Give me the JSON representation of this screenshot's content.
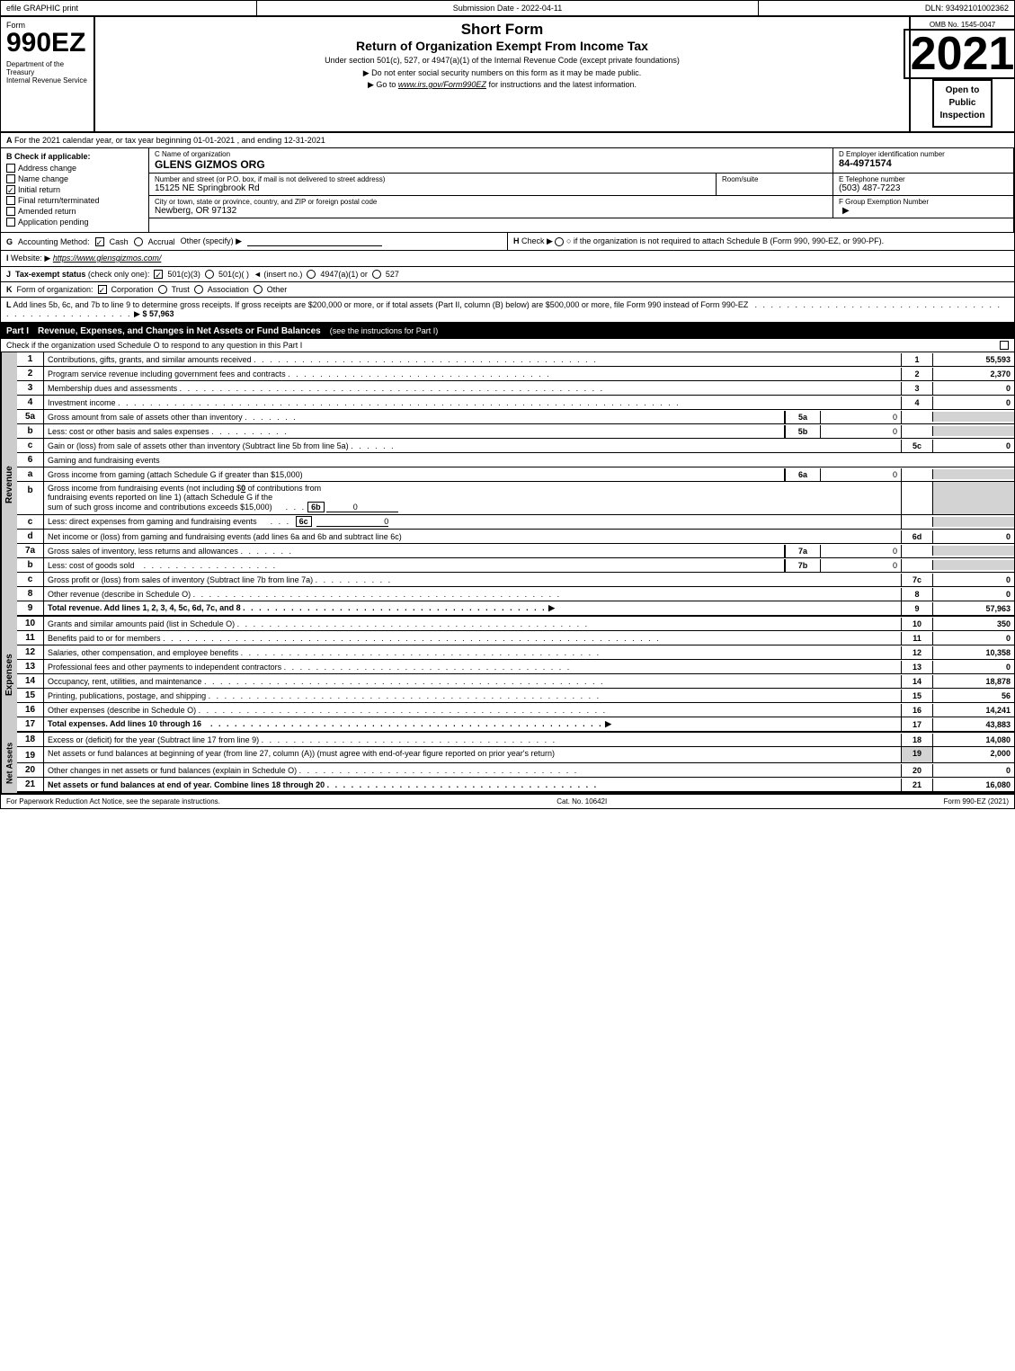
{
  "header": {
    "efile_label": "efile GRAPHIC print",
    "submission_date_label": "Submission Date - 2022-04-11",
    "dln_label": "DLN: 93492101002362",
    "form_number": "990EZ",
    "dept_label": "Department of the Treasury",
    "irs_label": "Internal Revenue Service",
    "short_form_title": "Short Form",
    "return_title": "Return of Organization Exempt From Income Tax",
    "under_section": "Under section 501(c), 527, or 4947(a)(1) of the Internal Revenue Code (except private foundations)",
    "no_ssn": "▶ Do not enter social security numbers on this form as it may be made public.",
    "go_to": "▶ Go to www.irs.gov/Form990EZ for instructions and the latest information.",
    "irs_url": "www.irs.gov/Form990EZ",
    "year": "2021",
    "omb": "OMB No. 1545-0047",
    "open_to": "Open to",
    "public": "Public",
    "inspection": "Inspection"
  },
  "section_a": {
    "label": "A",
    "text": "For the 2021 calendar year, or tax year beginning 01-01-2021 , and ending 12-31-2021"
  },
  "section_b": {
    "label": "B",
    "check_label": "Check if applicable:",
    "address_change": "Address change",
    "name_change": "Name change",
    "initial_return": "Initial return",
    "final_return": "Final return/terminated",
    "amended_return": "Amended return",
    "application_pending": "Application pending",
    "address_change_checked": false,
    "name_change_checked": false,
    "initial_return_checked": true,
    "final_return_checked": false,
    "amended_return_checked": false,
    "application_pending_checked": false
  },
  "org": {
    "name_label": "C Name of organization",
    "name": "GLENS GIZMOS ORG",
    "ein_label": "D Employer identification number",
    "ein": "84-4971574",
    "address_label": "Number and street (or P.O. box, if mail is not delivered to street address)",
    "address": "15125 NE Springbrook Rd",
    "room_label": "Room/suite",
    "room": "",
    "phone_label": "E Telephone number",
    "phone": "(503) 487-7223",
    "city_label": "City or town, state or province, country, and ZIP or foreign postal code",
    "city": "Newberg, OR  97132",
    "group_label": "F Group Exemption Number",
    "group_number": ""
  },
  "section_g": {
    "label": "G",
    "text": "Accounting Method:",
    "cash": "Cash",
    "accrual": "Accrual",
    "other": "Other (specify) ▶",
    "cash_checked": true,
    "accrual_checked": false
  },
  "section_h": {
    "label": "H",
    "text": "Check ▶",
    "option": "○ if the organization is not required to attach Schedule B (Form 990, 990-EZ, or 990-PF)."
  },
  "section_i": {
    "label": "I",
    "website_label": "Website: ▶",
    "website": "https://www.glensgizmos.com/"
  },
  "section_j": {
    "label": "J",
    "text": "Tax-exempt status (check only one):",
    "option1": "501(c)(3)",
    "option2": "501(c)(  )",
    "insert_no": "◄ (insert no.)",
    "option3": "4947(a)(1) or",
    "option4": "527",
    "checked": "501c3"
  },
  "section_k": {
    "label": "K",
    "text": "Form of organization:",
    "corporation": "Corporation",
    "trust": "Trust",
    "association": "Association",
    "other": "Other",
    "checked": "corporation"
  },
  "section_l": {
    "label": "L",
    "text": "Add lines 5b, 6c, and 7b to line 9 to determine gross receipts. If gross receipts are $200,000 or more, or if total assets (Part II, column (B) below) are $500,000 or more, file Form 990 instead of Form 990-EZ",
    "dots": ". . . . . . . . . . . . . . . . . . . . . . . . . . . . . . . . . . . . . . . . . . . . . . . .",
    "arrow": "▶",
    "amount": "$ 57,963"
  },
  "part1": {
    "label": "Part I",
    "title": "Revenue, Expenses, and Changes in Net Assets or Fund Balances",
    "see_instructions": "(see the instructions for Part I)",
    "check_schedule": "Check if the organization used Schedule O to respond to any question in this Part I",
    "rows": [
      {
        "num": "1",
        "desc": "Contributions, gifts, grants, and similar amounts received",
        "dots": true,
        "line": "1",
        "amount": "55,593",
        "sub_line": "",
        "sub_amount": ""
      },
      {
        "num": "2",
        "desc": "Program service revenue including government fees and contracts",
        "dots": true,
        "line": "2",
        "amount": "2,370",
        "sub_line": "",
        "sub_amount": ""
      },
      {
        "num": "3",
        "desc": "Membership dues and assessments",
        "dots": true,
        "line": "3",
        "amount": "0",
        "sub_line": "",
        "sub_amount": ""
      },
      {
        "num": "4",
        "desc": "Investment income",
        "dots": true,
        "line": "4",
        "amount": "0",
        "sub_line": "",
        "sub_amount": ""
      },
      {
        "num": "5a",
        "desc": "Gross amount from sale of assets other than inventory",
        "dots": false,
        "line": "",
        "amount": "",
        "sub_line": "5a",
        "sub_amount": "0"
      },
      {
        "num": "b",
        "desc": "Less: cost or other basis and sales expenses",
        "dots": false,
        "line": "",
        "amount": "",
        "sub_line": "5b",
        "sub_amount": "0"
      },
      {
        "num": "c",
        "desc": "Gain or (loss) from sale of assets other than inventory (Subtract line 5b from line 5a)",
        "dots": true,
        "line": "5c",
        "amount": "0",
        "sub_line": "",
        "sub_amount": ""
      }
    ],
    "row6": {
      "num": "6",
      "desc": "Gaming and fundraising events"
    },
    "row6a": {
      "num": "a",
      "desc": "Gross income from gaming (attach Schedule G if greater than $15,000)",
      "sub_line": "6a",
      "sub_amount": "0"
    },
    "row6b": {
      "num": "b",
      "desc1": "Gross income from fundraising events (not including $",
      "amount_inline": "0",
      "desc2": " of contributions from fundraising events reported on line 1) (attach Schedule G if the sum of such gross income and contributions exceeds $15,000)",
      "sub_line": "6b",
      "sub_amount": "0"
    },
    "row6c": {
      "num": "c",
      "desc": "Less: direct expenses from gaming and fundraising events",
      "sub_line": "6c",
      "sub_amount": "0"
    },
    "row6d": {
      "num": "d",
      "desc": "Net income or (loss) from gaming and fundraising events (add lines 6a and 6b and subtract line 6c)",
      "line": "6d",
      "amount": "0"
    },
    "row7a": {
      "num": "7a",
      "desc": "Gross sales of inventory, less returns and allowances",
      "sub_line": "7a",
      "sub_amount": "0"
    },
    "row7b": {
      "num": "b",
      "desc": "Less: cost of goods sold",
      "sub_line": "7b",
      "sub_amount": "0"
    },
    "row7c": {
      "num": "c",
      "desc": "Gross profit or (loss) from sales of inventory (Subtract line 7b from line 7a)",
      "dots": true,
      "line": "7c",
      "amount": "0"
    },
    "row8": {
      "num": "8",
      "desc": "Other revenue (describe in Schedule O)",
      "dots": true,
      "line": "8",
      "amount": "0"
    },
    "row9": {
      "num": "9",
      "desc": "Total revenue. Add lines 1, 2, 3, 4, 5c, 6d, 7c, and 8",
      "dots": true,
      "arrow": "▶",
      "line": "9",
      "amount": "57,963"
    }
  },
  "part1_expenses": {
    "row10": {
      "num": "10",
      "desc": "Grants and similar amounts paid (list in Schedule O)",
      "dots": true,
      "line": "10",
      "amount": "350"
    },
    "row11": {
      "num": "11",
      "desc": "Benefits paid to or for members",
      "dots": true,
      "line": "11",
      "amount": "0"
    },
    "row12": {
      "num": "12",
      "desc": "Salaries, other compensation, and employee benefits",
      "dots": true,
      "line": "12",
      "amount": "10,358"
    },
    "row13": {
      "num": "13",
      "desc": "Professional fees and other payments to independent contractors",
      "dots": true,
      "line": "13",
      "amount": "0"
    },
    "row14": {
      "num": "14",
      "desc": "Occupancy, rent, utilities, and maintenance",
      "dots": true,
      "line": "14",
      "amount": "18,878"
    },
    "row15": {
      "num": "15",
      "desc": "Printing, publications, postage, and shipping",
      "dots": true,
      "line": "15",
      "amount": "56"
    },
    "row16": {
      "num": "16",
      "desc": "Other expenses (describe in Schedule O)",
      "dots": true,
      "line": "16",
      "amount": "14,241"
    },
    "row17": {
      "num": "17",
      "desc": "Total expenses. Add lines 10 through 16",
      "dots": true,
      "arrow": "▶",
      "line": "17",
      "amount": "43,883"
    }
  },
  "part1_assets": {
    "row18": {
      "num": "18",
      "desc": "Excess or (deficit) for the year (Subtract line 17 from line 9)",
      "dots": true,
      "line": "18",
      "amount": "14,080"
    },
    "row19_label": "Net assets or fund balances at beginning of year (from line 27, column (A)) (must agree with end-of-year figure reported on prior year's return)",
    "row19": {
      "num": "19",
      "line": "19",
      "amount": "2,000"
    },
    "row20": {
      "num": "20",
      "desc": "Other changes in net assets or fund balances (explain in Schedule O)",
      "dots": true,
      "line": "20",
      "amount": "0"
    },
    "row21": {
      "num": "21",
      "desc": "Net assets or fund balances at end of year. Combine lines 18 through 20",
      "dots": true,
      "line": "21",
      "amount": "16,080"
    }
  },
  "footer": {
    "paperwork_notice": "For Paperwork Reduction Act Notice, see the separate instructions.",
    "cat_no": "Cat. No. 10642I",
    "form_ref": "Form 990-EZ (2021)"
  }
}
